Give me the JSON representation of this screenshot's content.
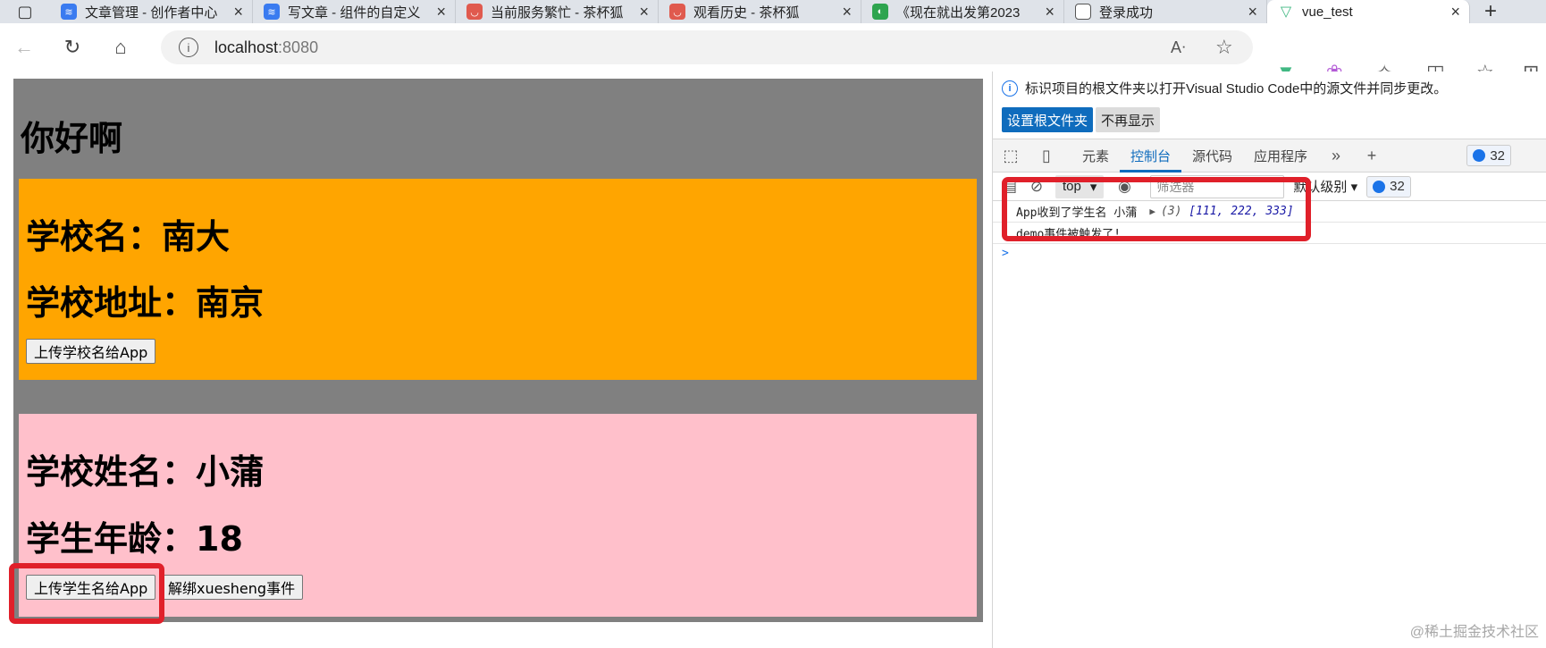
{
  "browser": {
    "tabs": [
      {
        "title": "文章管理 - 创作者中心",
        "icon_color": "#3a7bf0",
        "icon": "layers-icon"
      },
      {
        "title": "写文章 - 组件的自定义",
        "icon_color": "#3a7bf0",
        "icon": "layers-icon"
      },
      {
        "title": "当前服务繁忙 - 茶杯狐",
        "icon_color": "#e05a4e",
        "icon": "cup-icon"
      },
      {
        "title": "观看历史 - 茶杯狐",
        "icon_color": "#e05a4e",
        "icon": "cup-icon"
      },
      {
        "title": "《现在就出发第2023",
        "icon_color": "#2ea44f",
        "icon": "leaf-icon"
      },
      {
        "title": "登录成功",
        "icon_color": "#777777",
        "icon": "page-icon"
      },
      {
        "title": "vue_test",
        "icon_color": "#41b883",
        "icon": "vue-icon"
      }
    ],
    "active_tab_index": 6,
    "url_host": "localhost",
    "url_port": ":8080"
  },
  "app": {
    "heading": "你好啊",
    "school": {
      "name_line": "学校名：南大",
      "address_line": "学校地址：南京",
      "button": "上传学校名给App",
      "bg_color": "#ffa500"
    },
    "student": {
      "name_line": "学校姓名：小蒲",
      "age_line": "学生年龄：18",
      "button_send": "上传学生名给App",
      "button_unbind": "解绑xuesheng事件",
      "bg_color": "#ffc0cb"
    }
  },
  "devtools": {
    "info_text": "标识项目的根文件夹以打开Visual Studio Code中的源文件并同步更改。",
    "set_root_button": "设置根文件夹",
    "dismiss_button": "不再显示",
    "tabs": [
      "元素",
      "控制台",
      "源代码",
      "应用程序"
    ],
    "active_tab": "控制台",
    "issues_count": "32",
    "context": "top",
    "filter_placeholder": "筛选器",
    "level_label": "默认级别",
    "console_lines": [
      {
        "text": "App收到了学生名 小蒲",
        "count": "(3)",
        "value": "[111, 222, 333]"
      },
      {
        "text": "demo事件被触发了!"
      }
    ],
    "prompt": ">"
  },
  "watermark": "@稀土掘金技术社区",
  "colors": {
    "highlight": "#e0202a",
    "devtools_accent": "#0f6cbd"
  }
}
